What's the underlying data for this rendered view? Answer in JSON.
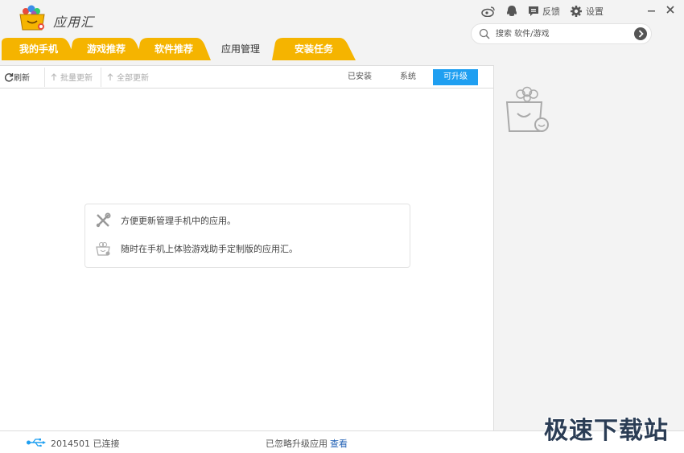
{
  "app": {
    "title": "应用汇",
    "logo": "app-logo-bag-icon"
  },
  "top_bar": {
    "weibo_icon": "weibo-icon",
    "qq_icon": "qq-penguin-icon",
    "feedback_label": "反馈",
    "settings_label": "设置",
    "minimize_icon": "minimize-icon",
    "close_icon": "close-icon"
  },
  "search": {
    "placeholder": "搜索 软件/游戏"
  },
  "tabs": [
    {
      "label": "我的手机",
      "active": false
    },
    {
      "label": "游戏推荐",
      "active": false
    },
    {
      "label": "软件推荐",
      "active": false
    },
    {
      "label": "应用管理",
      "active": true
    },
    {
      "label": "安装任务",
      "active": false
    }
  ],
  "toolbar": {
    "refresh": "刷新",
    "batch_update": "批量更新",
    "update_all": "全部更新",
    "filters": [
      {
        "label": "已安装",
        "active": false
      },
      {
        "label": "系统",
        "active": false
      },
      {
        "label": "可升级",
        "active": true
      }
    ]
  },
  "info": {
    "line1": "方便更新管理手机中的应用。",
    "line2": "随时在手机上体验游戏助手定制版的应用汇。"
  },
  "status": {
    "device": "2014501 已连接",
    "ignored": "已忽略升级应用",
    "view": "查看"
  },
  "watermark": "极速下载站",
  "colors": {
    "tab_orange": "#f5b400",
    "accent_blue": "#1f9ff1",
    "link_blue": "#1f5fb4"
  }
}
